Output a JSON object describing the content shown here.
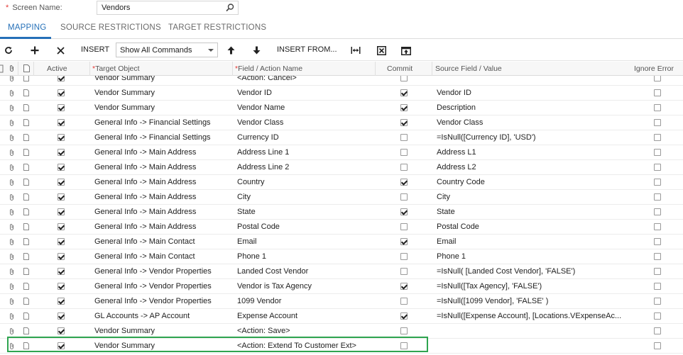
{
  "form": {
    "required_mark": "*",
    "screen_name_label": "Screen Name:",
    "screen_name_value": "Vendors"
  },
  "tabs": [
    {
      "label": "MAPPING",
      "active": true
    },
    {
      "label": "SOURCE RESTRICTIONS",
      "active": false
    },
    {
      "label": "TARGET RESTRICTIONS",
      "active": false
    }
  ],
  "toolbar": {
    "insert_label": "INSERT",
    "commands_select": "Show All Commands",
    "insert_from_label": "INSERT FROM..."
  },
  "columns": {
    "active": "Active",
    "target_object": "Target Object",
    "field_action": "Field / Action Name",
    "commit": "Commit",
    "source_field": "Source Field / Value",
    "ignore_error": "Ignore Error"
  },
  "rows": [
    {
      "target": "Vendor Summary",
      "field": "<Action: Cancel>",
      "source": "",
      "active": true,
      "commit": false,
      "ignore": false
    },
    {
      "target": "Vendor Summary",
      "field": "Vendor ID",
      "source": "Vendor ID",
      "active": true,
      "commit": true,
      "ignore": false
    },
    {
      "target": "Vendor Summary",
      "field": "Vendor Name",
      "source": "Description",
      "active": true,
      "commit": true,
      "ignore": false
    },
    {
      "target": "General Info -> Financial Settings",
      "field": "Vendor Class",
      "source": "Vendor Class",
      "active": true,
      "commit": true,
      "ignore": false
    },
    {
      "target": "General Info -> Financial Settings",
      "field": "Currency ID",
      "source": "=IsNull([Currency ID], 'USD')",
      "active": true,
      "commit": false,
      "ignore": false
    },
    {
      "target": "General Info -> Main Address",
      "field": "Address Line 1",
      "source": "Address L1",
      "active": true,
      "commit": false,
      "ignore": false
    },
    {
      "target": "General Info -> Main Address",
      "field": "Address Line 2",
      "source": "Address L2",
      "active": true,
      "commit": false,
      "ignore": false
    },
    {
      "target": "General Info -> Main Address",
      "field": "Country",
      "source": "Country Code",
      "active": true,
      "commit": true,
      "ignore": false
    },
    {
      "target": "General Info -> Main Address",
      "field": "City",
      "source": "City",
      "active": true,
      "commit": false,
      "ignore": false
    },
    {
      "target": "General Info -> Main Address",
      "field": "State",
      "source": "State",
      "active": true,
      "commit": true,
      "ignore": false
    },
    {
      "target": "General Info -> Main Address",
      "field": "Postal Code",
      "source": "Postal Code",
      "active": true,
      "commit": false,
      "ignore": false
    },
    {
      "target": "General Info -> Main Contact",
      "field": "Email",
      "source": "Email",
      "active": true,
      "commit": true,
      "ignore": false
    },
    {
      "target": "General Info -> Main Contact",
      "field": "Phone 1",
      "source": "Phone 1",
      "active": true,
      "commit": false,
      "ignore": false
    },
    {
      "target": "General Info -> Vendor Properties",
      "field": "Landed Cost Vendor",
      "source": "=IsNull( [Landed Cost Vendor], 'FALSE')",
      "active": true,
      "commit": false,
      "ignore": false
    },
    {
      "target": "General Info -> Vendor Properties",
      "field": "Vendor is Tax Agency",
      "source": "=IsNull([Tax Agency], 'FALSE')",
      "active": true,
      "commit": true,
      "ignore": false
    },
    {
      "target": "General Info -> Vendor Properties",
      "field": "1099 Vendor",
      "source": "=IsNull([1099 Vendor], 'FALSE' )",
      "active": true,
      "commit": false,
      "ignore": false
    },
    {
      "target": "GL Accounts -> AP Account",
      "field": "Expense Account",
      "source": "=IsNull([Expense Account], [Locations.VExpenseAc...",
      "active": true,
      "commit": true,
      "ignore": false
    },
    {
      "target": "Vendor Summary",
      "field": "<Action: Save>",
      "source": "",
      "active": true,
      "commit": false,
      "ignore": false
    },
    {
      "target": "Vendor Summary",
      "field": "<Action: Extend To Customer Ext>",
      "source": "",
      "active": true,
      "commit": false,
      "ignore": false
    }
  ],
  "colors": {
    "accent": "#2570b8",
    "highlight_border": "#2ea44f",
    "required": "#e53935"
  }
}
